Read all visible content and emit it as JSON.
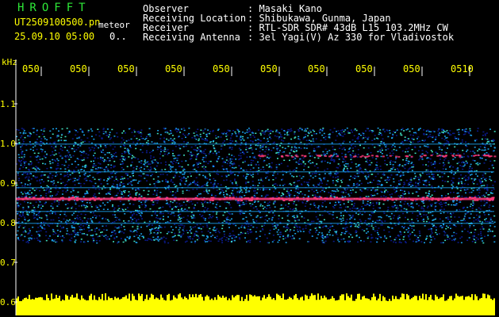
{
  "header": {
    "program": "HROFFT",
    "filename": "UT2509100500.pn",
    "tag": "meteor",
    "datetime": "25.09.10 05:00",
    "count": "0..",
    "fields": [
      {
        "label": "Observer",
        "value": ": Masaki Kano"
      },
      {
        "label": "Receiving Location",
        "value": ": Shibukawa, Gunma, Japan"
      },
      {
        "label": "Receiver",
        "value": ": RTL-SDR SDR# 43dB L15 103.2MHz CW"
      },
      {
        "label": "Receiving Antenna",
        "value": ": 3el Yagi(V) Az 330 for Vladivostok"
      }
    ]
  },
  "chart_data": {
    "type": "heatmap",
    "ylabel": "kHz",
    "y_ticks": [
      "1.1",
      "1.0",
      "0.9",
      "0.8",
      "0.7",
      "0.6"
    ],
    "ylim": [
      0.6,
      1.15
    ],
    "x_ticks": [
      "050",
      "050",
      "050",
      "050",
      "050",
      "050",
      "050",
      "050",
      "050",
      "0510"
    ],
    "signal_band": [
      0.75,
      1.04
    ],
    "strong_lines": [
      0.86,
      0.97
    ],
    "colors": {
      "background": "#000000",
      "noise_low": "#0a1a8c",
      "noise_mid": "#1aa0e8",
      "noise_high": "#40e0c0",
      "line_hot": "#ff3a7a",
      "trace": "#ffff00",
      "axis": "#ffffff"
    }
  }
}
